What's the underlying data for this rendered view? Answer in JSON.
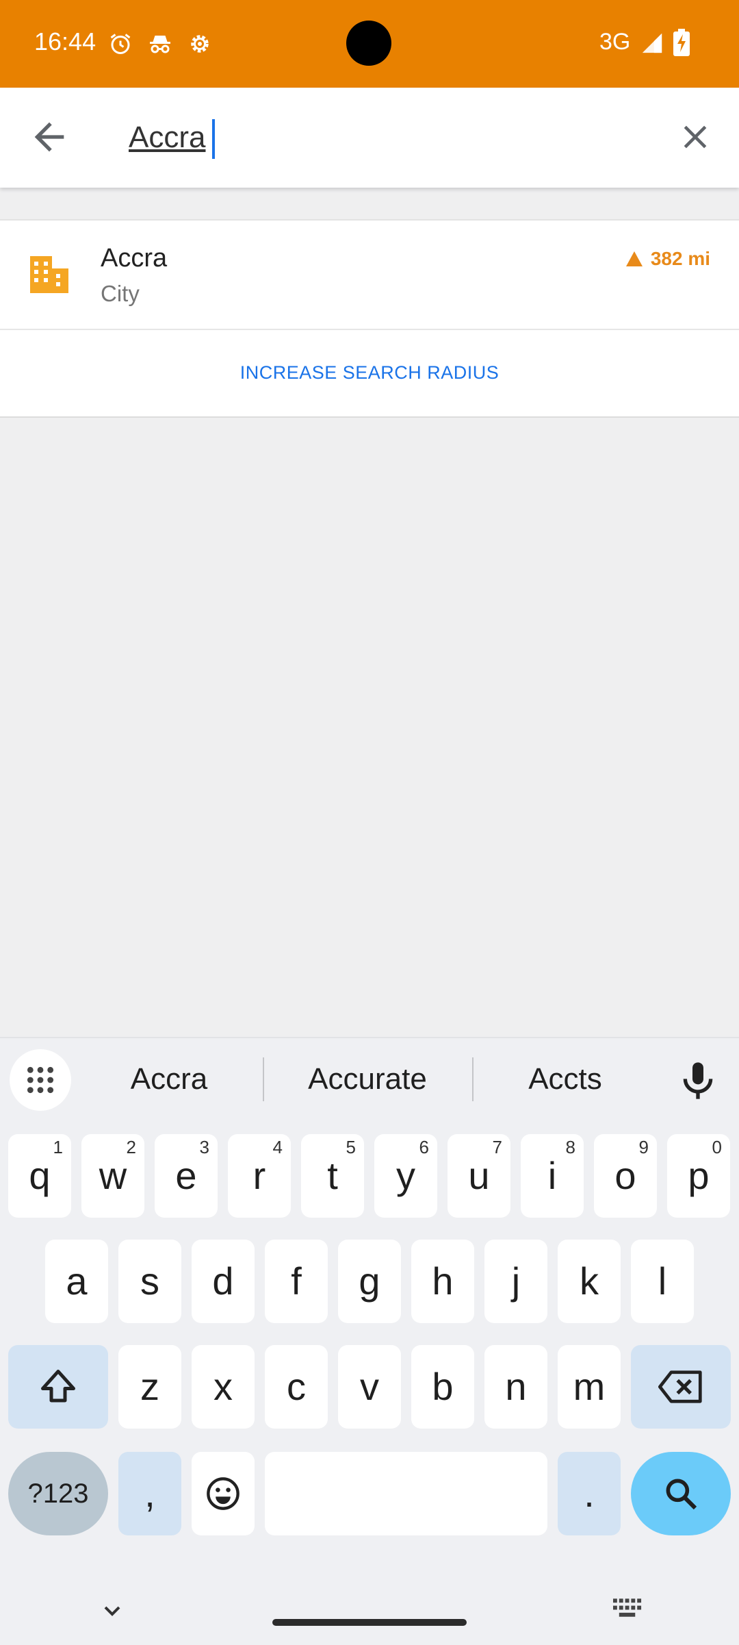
{
  "status_bar": {
    "time": "16:44",
    "network": "3G",
    "background_color": "#e88100",
    "icons": [
      "alarm-icon",
      "incognito-icon",
      "settings-gear-icon",
      "signal-icon",
      "battery-charging-icon"
    ]
  },
  "search": {
    "value": "Accra",
    "back_icon": "arrow-back-icon",
    "clear_icon": "close-icon"
  },
  "results": [
    {
      "name": "Accra",
      "type": "City",
      "distance": "382 mi",
      "icon": "city-building-icon",
      "accent_color": "#e88a1a"
    }
  ],
  "increase_radius_label": "INCREASE SEARCH RADIUS",
  "keyboard": {
    "suggestions": [
      "Accra",
      "Accurate",
      "Accts"
    ],
    "row1": [
      {
        "key": "q",
        "sup": "1"
      },
      {
        "key": "w",
        "sup": "2"
      },
      {
        "key": "e",
        "sup": "3"
      },
      {
        "key": "r",
        "sup": "4"
      },
      {
        "key": "t",
        "sup": "5"
      },
      {
        "key": "y",
        "sup": "6"
      },
      {
        "key": "u",
        "sup": "7"
      },
      {
        "key": "i",
        "sup": "8"
      },
      {
        "key": "o",
        "sup": "9"
      },
      {
        "key": "p",
        "sup": "0"
      }
    ],
    "row2": [
      "a",
      "s",
      "d",
      "f",
      "g",
      "h",
      "j",
      "k",
      "l"
    ],
    "row3": [
      "z",
      "x",
      "c",
      "v",
      "b",
      "n",
      "m"
    ],
    "symbols_label": "?123",
    "comma": ",",
    "period": ".",
    "accent_color": "#6bcbf9"
  }
}
